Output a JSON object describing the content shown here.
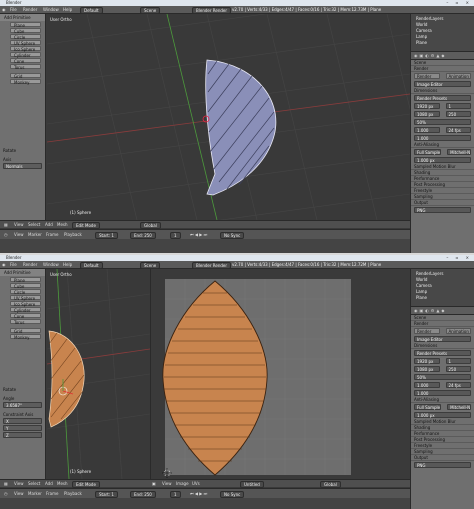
{
  "window": {
    "title": "Blender",
    "controls": "– ▫ ×"
  },
  "infobar": {
    "menus": [
      "File",
      "Render",
      "Window",
      "Help"
    ],
    "layout": "Default",
    "scene": "Scene",
    "engine": "Blender Render",
    "stats_top": "v2.70 | Verts:4/33 | Edges:4/47 | Faces:0/16 | Tris:32 | Mem:12.73M | Plane",
    "stats_bottom": "v2.70 | Verts:4/33 | Edges:4/47 | Faces:0/16 | Tris:32 | Mem:12.72M | Plane"
  },
  "tools": {
    "header": "Add Primitive",
    "items": [
      "Plane",
      "Cube",
      "Circle",
      "UV Sphere",
      "Ico Sphere",
      "Cylinder",
      "Cone",
      "Torus",
      "Grid",
      "Monkey"
    ]
  },
  "viewport": {
    "label": "User Ortho",
    "object_label": "(1) Sphere"
  },
  "top_panel": {
    "header": "Rotate",
    "label": "Axis",
    "value": "Normals"
  },
  "bottom_panel": {
    "header": "Rotate",
    "value_label": "Angle",
    "value": "3.6587°",
    "constraint_header": "Constraint Axis",
    "axis_x": "X",
    "axis_y": "Y",
    "axis_z": "Z"
  },
  "header_bar": {
    "menus": [
      "View",
      "Select",
      "Add",
      "Mesh"
    ],
    "mode": "Edit Mode",
    "pivot": "Global"
  },
  "bottom_header_bar": {
    "menus": [
      "View",
      "Select",
      "Add",
      "Mesh"
    ],
    "mode": "Edit Mode",
    "pivot": "Global",
    "image_menus": [
      "View",
      "Image",
      "UVs"
    ],
    "image_slot": "Untitled"
  },
  "timeline": {
    "menus": [
      "View",
      "Marker",
      "Frame",
      "Playback"
    ],
    "start": "Start: 1",
    "end": "End: 250",
    "current": "1",
    "sync": "No Sync"
  },
  "outliner": {
    "items": [
      "RenderLayers",
      "World",
      "Camera",
      "Lamp",
      "Plane"
    ]
  },
  "props_top": {
    "scene_row": "Scene",
    "sections": [
      "Render",
      "Dimensions",
      "Anti-Aliasing",
      "Sampled Motion Blur",
      "Shading",
      "Performance",
      "Post Processing",
      "Freestyle",
      "Sampling",
      "Output"
    ],
    "render_btn": "Render",
    "anim_btn": "Animation",
    "display": "Image Editor",
    "preset": "Render Presets",
    "res_x": "1920 px",
    "res_y": "1080 px",
    "res_pct": "50%",
    "frame_start": "1",
    "frame_end": "250",
    "aspect_x": "1.000",
    "aspect_y": "1.000",
    "fps": "24 fps",
    "aa_samples": "Mitchell-N",
    "full_sample": "Full Sample",
    "size": "1.000 px",
    "format": "PNG"
  },
  "props_bottom": {
    "scene_row": "Scene",
    "sections": [
      "Render",
      "Dimensions",
      "Anti-Aliasing",
      "Sampled Motion Blur",
      "Shading",
      "Performance",
      "Post Processing",
      "Freestyle",
      "Sampling",
      "Output"
    ],
    "render_btn": "Render",
    "anim_btn": "Animation",
    "display": "Image Editor",
    "preset": "Render Presets",
    "res_x": "1920 px",
    "res_y": "1080 px",
    "res_pct": "50%",
    "frame_start": "1",
    "frame_end": "250",
    "aspect_x": "1.000",
    "aspect_y": "1.000",
    "fps": "24 fps",
    "aa_samples": "Mitchell-N",
    "full_sample": "Full Sample",
    "size": "1.000 px",
    "format": "PNG"
  },
  "colors": {
    "mesh_top": "#8a8fb8",
    "mesh_bottom": "#c8844e",
    "grid_line": "#444444",
    "axis_green": "#4c9a3c",
    "axis_red": "#9a3c3c"
  }
}
